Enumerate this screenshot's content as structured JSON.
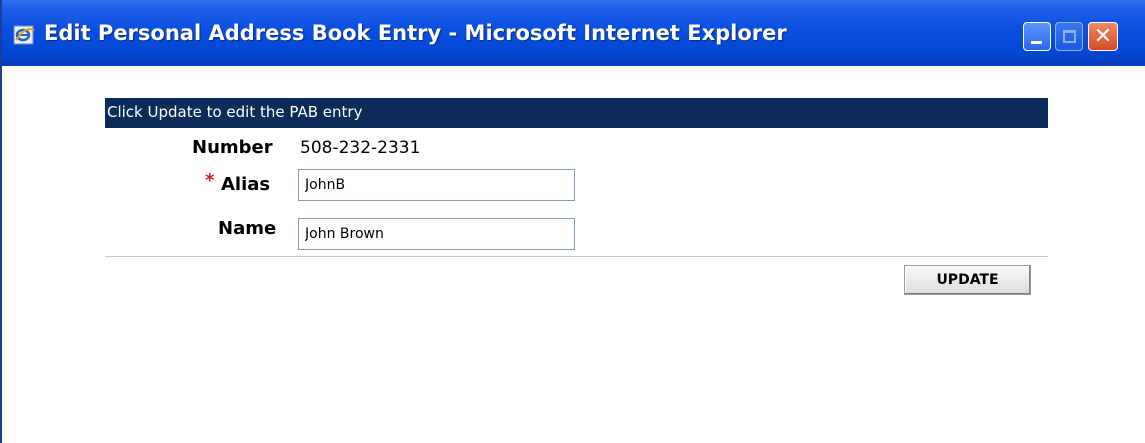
{
  "window": {
    "title": "Edit Personal Address Book Entry - Microsoft Internet Explorer",
    "icon": "ie-icon",
    "controls": [
      "minimize-icon",
      "maximize-icon",
      "close-icon"
    ]
  },
  "form": {
    "header": "Click Update to edit the PAB entry",
    "number_label": "Number",
    "number_value": "508-232-2331",
    "required_marker": "*",
    "alias_label": "Alias",
    "alias_value": "JohnB",
    "name_label": "Name",
    "name_value": "John Brown",
    "update_label": "UPDATE"
  },
  "colors": {
    "titlebar": "#0a4fe0",
    "header_bar": "#0b2b5a",
    "required": "#d42020"
  }
}
